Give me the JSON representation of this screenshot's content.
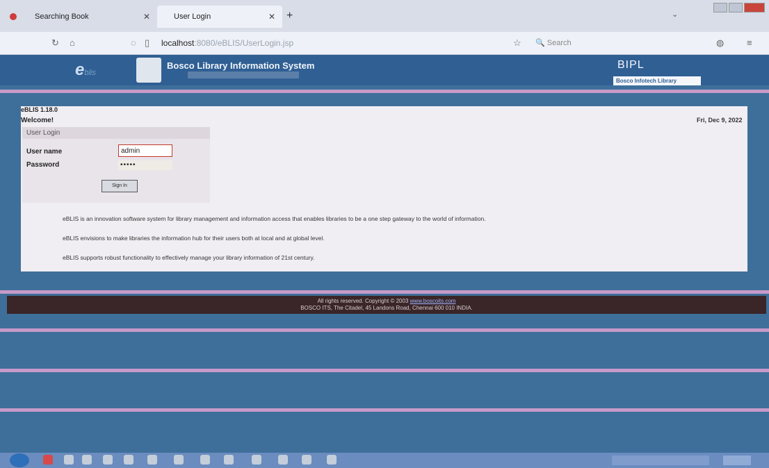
{
  "browser": {
    "tabs": [
      {
        "label": "Searching Book"
      },
      {
        "label": "User Login"
      }
    ],
    "new_tab": "+",
    "url_host": "localhost",
    "url_path": ":8080/eBLIS/UserLogin.jsp",
    "search_placeholder": "Search"
  },
  "header": {
    "logo_text": "e",
    "logo_sub": "blis",
    "brand": "Bosco Library Information System",
    "right_logo": "BIPL",
    "library_badge": "Bosco Infotech Library"
  },
  "content": {
    "version": "eBLIS 1.18.0",
    "welcome": "Welcome!",
    "date": "Fri, Dec 9, 2022",
    "login_title": "User Login",
    "username_label": "User name",
    "password_label": "Password",
    "username_value": "admin",
    "password_value": "•••••",
    "signin_label": "Sign In",
    "descriptions": [
      "eBLIS is an innovation software system for library management and information access that enables libraries to be a one step gateway to the world of information.",
      "eBLIS envisions to make libraries the information hub for their users both at local and at global level.",
      "eBLIS supports robust functionality to effectively manage your library information of 21st century."
    ]
  },
  "footer": {
    "line1": "All rights reserved. Copyright © 2003",
    "link": "www.boscoits.com",
    "line2": "BOSCO ITS, The Citadel, 45 Landons Road, Chennai 600 010 INDIA."
  },
  "colors": {
    "header": "#2f5f93",
    "stripe": "#c79ac8",
    "footer": "#3a2528",
    "panel": "#f1eef3"
  }
}
